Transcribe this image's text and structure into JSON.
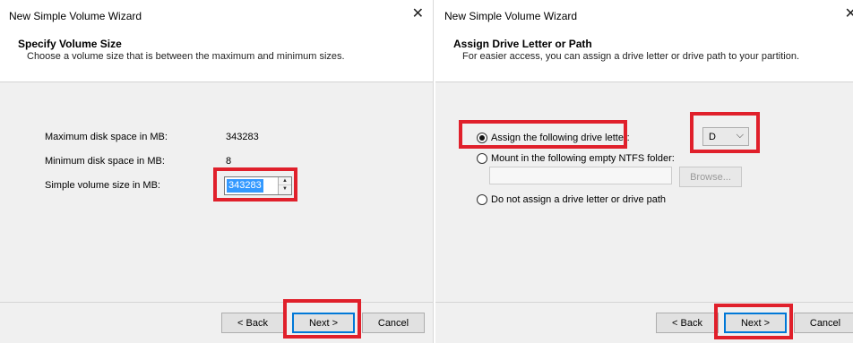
{
  "left_wizard": {
    "title": "New Simple Volume Wizard",
    "close_glyph": "✕",
    "header_title": "Specify Volume Size",
    "header_subtitle": "Choose a volume size that is between the maximum and minimum sizes.",
    "max_label": "Maximum disk space in MB:",
    "max_value": "343283",
    "min_label": "Minimum disk space in MB:",
    "min_value": "8",
    "size_label": "Simple volume size in MB:",
    "size_value": "343283",
    "buttons": {
      "back": "< Back",
      "next": "Next >",
      "cancel": "Cancel"
    }
  },
  "right_wizard": {
    "title": "New Simple Volume Wizard",
    "close_glyph": "✕",
    "header_title": "Assign Drive Letter or Path",
    "header_subtitle": "For easier access, you can assign a drive letter or drive path to your partition.",
    "options": {
      "assign_letter": "Assign the following drive letter:",
      "mount_folder": "Mount in the following empty NTFS folder:",
      "no_assign": "Do not assign a drive letter or drive path"
    },
    "selected_option": "assign_letter",
    "drive_letter": "D",
    "browse_label": "Browse...",
    "buttons": {
      "back": "< Back",
      "next": "Next >",
      "cancel": "Cancel"
    }
  },
  "annotation_color": "#e0202b",
  "icons": {
    "close": "close-icon",
    "spin_up": "spin-up-icon",
    "spin_down": "spin-down-icon",
    "dropdown": "chevron-down-icon"
  }
}
